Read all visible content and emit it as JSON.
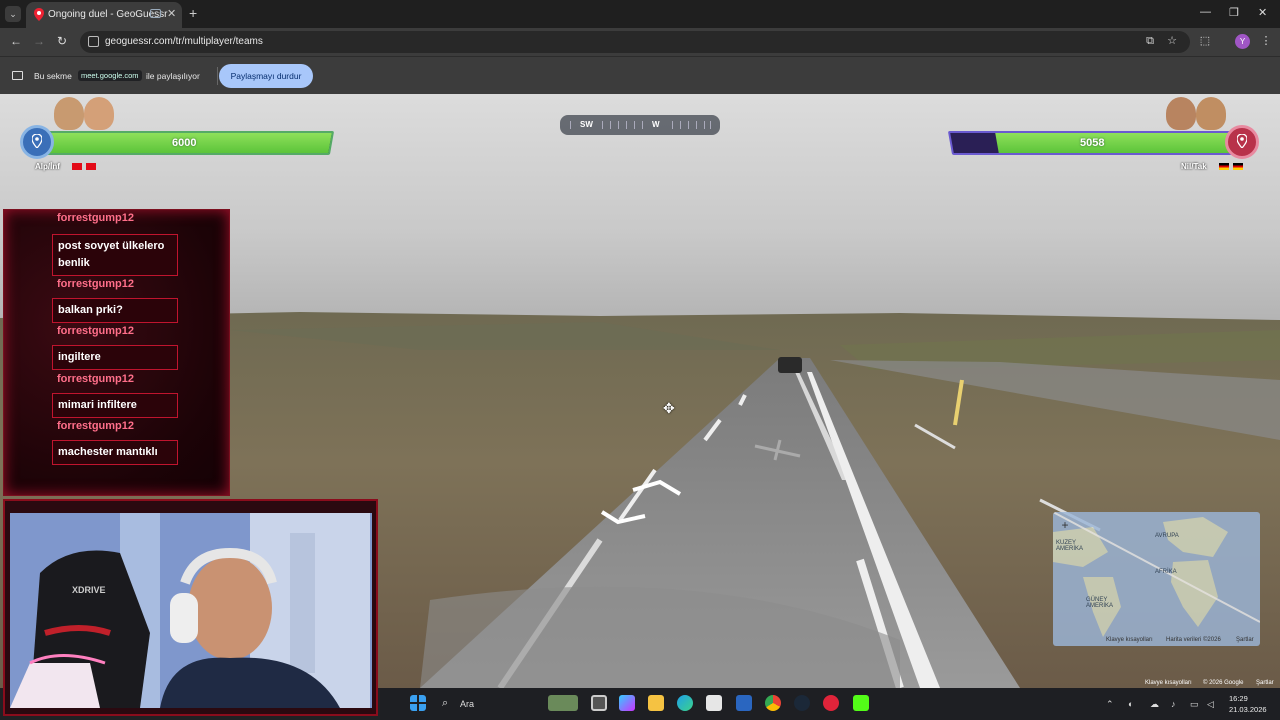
{
  "browser": {
    "tab_title": "Ongoing duel - GeoGuessr",
    "tab_close": "✕",
    "new_tab": "+",
    "url": "geoguessr.com/tr/multiplayer/teams",
    "profile_initial": "Y",
    "window_controls": {
      "minimize": "—",
      "restore": "❐",
      "close": "✕"
    }
  },
  "sharing_bar": {
    "prefix": "Bu sekme",
    "domain": "meet.google.com",
    "suffix": "ile paylaşılıyor",
    "stop_button": "Paylaşmayı durdur"
  },
  "game": {
    "compass": {
      "left_label": "SW",
      "center_label": "W"
    },
    "team_left": {
      "name": "Alp/İnf",
      "health": 6000,
      "health_fraction": 1.0,
      "color": "#3a6fb8"
    },
    "team_right": {
      "name": "Nil/Tak",
      "health": 5058,
      "health_fraction": 0.84,
      "color": "#b8324a"
    },
    "health_color": "#6fd446"
  },
  "chat": {
    "messages": [
      {
        "user": "forrestgump12",
        "text": "post sovyet ülkelero benlik"
      },
      {
        "user": "forrestgump12",
        "text": "balkan prki?"
      },
      {
        "user": "forrestgump12",
        "text": "ingiltere"
      },
      {
        "user": "forrestgump12",
        "text": "mimari infiltere"
      },
      {
        "user": "forrestgump12",
        "text": "machester mantıklı"
      }
    ]
  },
  "webcam": {
    "chair_brand": "XDRIVE"
  },
  "minimap": {
    "labels": {
      "europe": "AVRUPA",
      "africa": "AFRİKA",
      "south_america": "GÜNEY AMERİKA",
      "north_america": "KUZEY AMERİKA"
    },
    "footer": {
      "shortcuts": "Klavye kısayolları",
      "mapdata": "Harita verileri ©2026",
      "terms": "Şartlar"
    }
  },
  "streetview_footer": {
    "shortcuts": "Klavye kısayolları",
    "copyright": "© 2026 Google",
    "terms": "Şartlar"
  },
  "taskbar": {
    "search": "Ara",
    "time": "16:29",
    "date": "21.03.2026"
  }
}
